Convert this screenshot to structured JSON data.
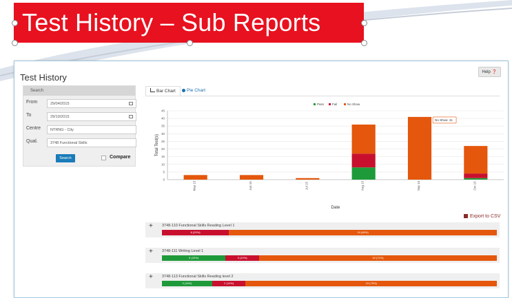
{
  "slide": {
    "title": "Test History – Sub Reports"
  },
  "app": {
    "page_title": "Test History",
    "help_label": "Help ❓",
    "search_panel": {
      "header": "Search",
      "from_label": "From",
      "from_value": "29/04/2015",
      "to_label": "To",
      "to_value": "29/10/2015",
      "centre_label": "Centre",
      "centre_value": "NTRNG - City",
      "qual_label": "Qual.",
      "qual_value": "3748 Functional Skills",
      "search_button": "Search",
      "compare_label": "Compare"
    },
    "tabs": [
      {
        "label": "Bar Chart",
        "icon": "bar-chart-icon",
        "active": true
      },
      {
        "label": "Pie Chart",
        "icon": "pie-chart-icon",
        "active": false
      }
    ],
    "export_label": "Export to CSV",
    "colors": {
      "pass": "#1f9a3a",
      "fail": "#c8102e",
      "no_show": "#e4570c",
      "accent": "#1a7bb9",
      "banner": "#e8111f"
    },
    "sub_reports": [
      {
        "title": "3748-110 Functional Skills Reading Level 1",
        "segments": [
          {
            "type": "fail",
            "value": 0.2,
            "label": "6 (20%)"
          },
          {
            "type": "noshow",
            "value": 0.8,
            "label": "24 (80%)"
          }
        ]
      },
      {
        "title": "3748-111 Writing Level 1",
        "segments": [
          {
            "type": "pass",
            "value": 0.19,
            "label": "6 (19%)"
          },
          {
            "type": "fail",
            "value": 0.1,
            "label": "3 (10%)"
          },
          {
            "type": "noshow",
            "value": 0.71,
            "label": "19 (71%)"
          }
        ]
      },
      {
        "title": "3748-113 Functional Skills Reading level 2",
        "segments": [
          {
            "type": "pass",
            "value": 0.15,
            "label": "3 (15%)"
          },
          {
            "type": "fail",
            "value": 0.1,
            "label": "2 (10%)"
          },
          {
            "type": "noshow",
            "value": 0.75,
            "label": "15 (75%)"
          }
        ]
      }
    ]
  },
  "chart_data": {
    "type": "bar",
    "stacked": true,
    "categories": [
      "May 15",
      "Jun 15",
      "Jul 15",
      "Aug 15",
      "Sep 15",
      "Oct 15"
    ],
    "series": [
      {
        "name": "Pass",
        "values": [
          0,
          0,
          0,
          8,
          0,
          1
        ]
      },
      {
        "name": "Fail",
        "values": [
          0,
          0,
          0,
          9,
          0,
          3
        ]
      },
      {
        "name": "No Show",
        "values": [
          3,
          3,
          1,
          19,
          41,
          18
        ]
      }
    ],
    "xlabel": "Date",
    "ylabel": "Total Test(s)",
    "ylim": [
      0,
      45
    ],
    "yticks": [
      0,
      5,
      10,
      15,
      20,
      25,
      30,
      35,
      40,
      45
    ],
    "legend": "top-center",
    "tooltip": "No Show: 41"
  }
}
